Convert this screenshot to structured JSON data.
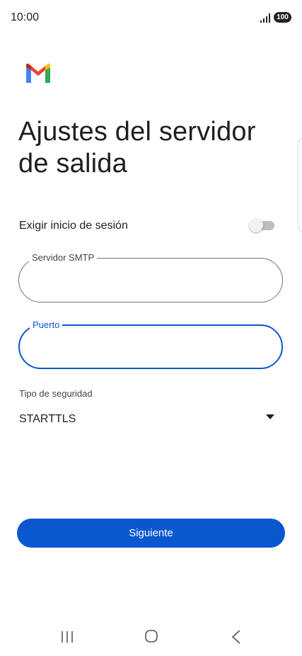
{
  "status_bar": {
    "time": "10:00",
    "battery_level": "100",
    "icons": [
      "signal-icon",
      "battery-icon"
    ]
  },
  "app": {
    "logo": "gmail-logo",
    "brand_colors": {
      "blue": "#4285F4",
      "red": "#EA4335",
      "yellow": "#FBBC04",
      "green": "#34A853"
    }
  },
  "page": {
    "title": "Ajustes del servidor de salida"
  },
  "require_login": {
    "label": "Exigir inicio de sesión",
    "enabled": false
  },
  "smtp_server": {
    "label": "Servidor SMTP",
    "value": ""
  },
  "port": {
    "label": "Puerto",
    "value": "",
    "focused": true
  },
  "security": {
    "caption": "Tipo de seguridad",
    "selected": "STARTTLS"
  },
  "actions": {
    "next_label": "Siguiente"
  },
  "navigation": {
    "icons": [
      "recent-apps-icon",
      "home-icon",
      "back-icon"
    ]
  },
  "colors": {
    "accent": "#0b57d0",
    "outline": "#747775",
    "text": "#1f1f1f"
  }
}
